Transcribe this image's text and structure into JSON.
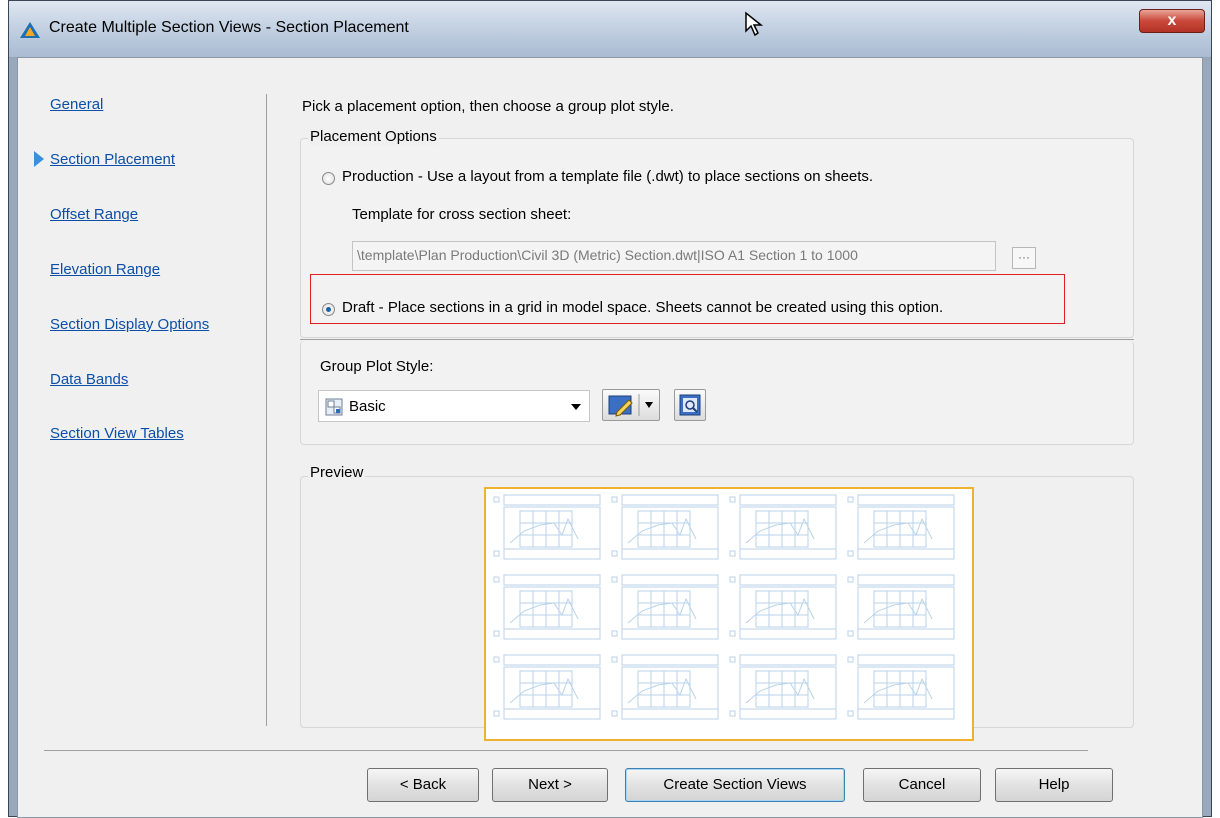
{
  "window": {
    "title": "Create Multiple Section Views - Section Placement",
    "close_label": "x"
  },
  "nav": {
    "items": [
      {
        "label": "General",
        "current": false
      },
      {
        "label": "Section Placement",
        "current": true
      },
      {
        "label": "Offset Range",
        "current": false
      },
      {
        "label": "Elevation Range",
        "current": false
      },
      {
        "label": "Section Display Options",
        "current": false
      },
      {
        "label": "Data Bands",
        "current": false
      },
      {
        "label": "Section View Tables",
        "current": false
      }
    ]
  },
  "main": {
    "instruction": "Pick a placement option, then choose a group plot style.",
    "placement_options": {
      "label": "Placement Options",
      "production": {
        "label": "Production - Use a layout from a template file (.dwt) to place sections on sheets.",
        "selected": false
      },
      "template_label": "Template for cross section sheet:",
      "template_value": "\\template\\Plan Production\\Civil 3D (Metric) Section.dwt|ISO A1 Section 1 to 1000",
      "browse_label": "···",
      "draft": {
        "label": "Draft - Place sections in a grid in model space. Sheets cannot be created using this option.",
        "selected": true
      }
    },
    "group_plot_style": {
      "label": "Group Plot Style:",
      "value": "Basic"
    },
    "preview": {
      "label": "Preview"
    }
  },
  "buttons": {
    "back": "< Back",
    "next": "Next >",
    "create": "Create Section Views",
    "cancel": "Cancel",
    "help": "Help"
  },
  "colors": {
    "link": "#0b4fa8",
    "highlight": "#e02020",
    "preview_border": "#f0b22e",
    "nav_arrow": "#3d8fd8"
  }
}
